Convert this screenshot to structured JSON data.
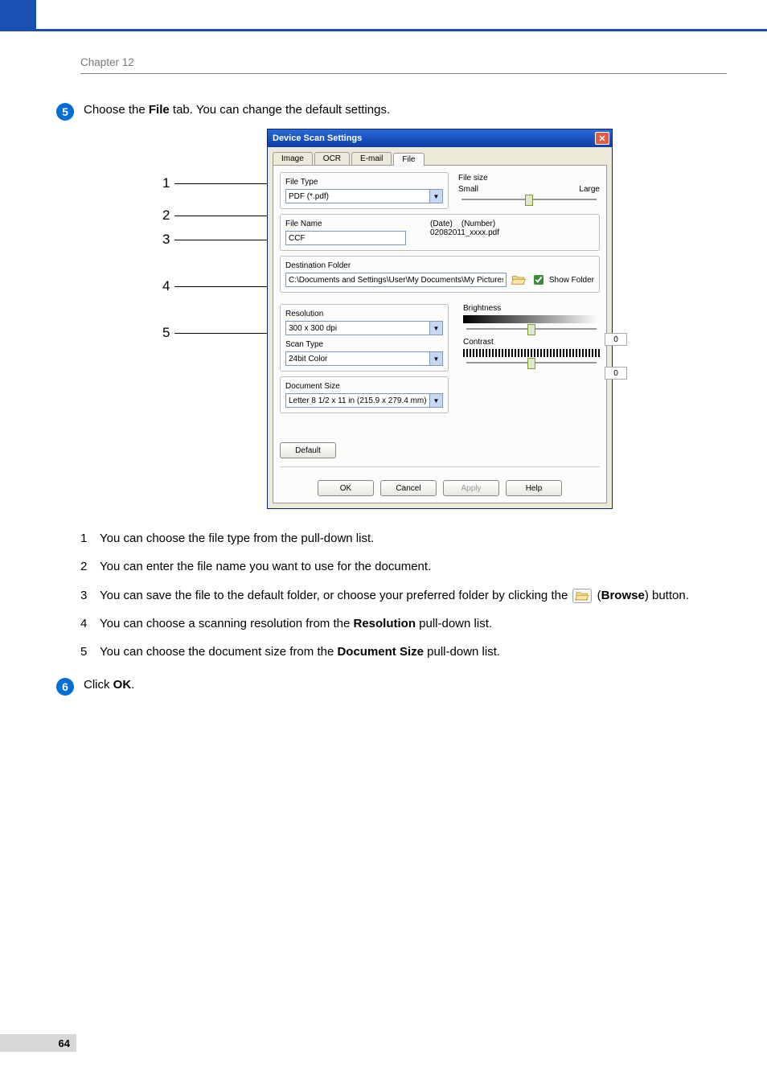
{
  "chapter": "Chapter 12",
  "page_number": "64",
  "step5": {
    "badge": "5",
    "pre": "Choose the ",
    "bold": "File",
    "post": " tab. You can change the default settings."
  },
  "step6": {
    "badge": "6",
    "pre": "Click ",
    "bold": "OK",
    "post": "."
  },
  "callouts": {
    "n1": "1",
    "n2": "2",
    "n3": "3",
    "n4": "4",
    "n5": "5"
  },
  "dialog": {
    "title": "Device Scan Settings",
    "tabs": {
      "image": "Image",
      "ocr": "OCR",
      "email": "E-mail",
      "file": "File"
    },
    "file_type_label": "File Type",
    "file_type_value": "PDF (*.pdf)",
    "file_size_label": "File size",
    "file_size_small": "Small",
    "file_size_large": "Large",
    "file_name_label": "File Name",
    "file_name_value": "CCF",
    "file_name_date": "(Date)",
    "file_name_number": "(Number)",
    "file_name_sample": "02082011_xxxx.pdf",
    "dest_folder_label": "Destination Folder",
    "dest_folder_value": "C:\\Documents and Settings\\User\\My Documents\\My Pictures\\Cc",
    "show_folder_label": "Show Folder",
    "resolution_label": "Resolution",
    "resolution_value": "300 x 300 dpi",
    "scan_type_label": "Scan Type",
    "scan_type_value": "24bit Color",
    "document_size_label": "Document Size",
    "document_size_value": "Letter 8 1/2 x 11 in (215.9 x 279.4 mm)",
    "brightness_label": "Brightness",
    "brightness_value": "0",
    "contrast_label": "Contrast",
    "contrast_value": "0",
    "default_btn": "Default",
    "ok_btn": "OK",
    "cancel_btn": "Cancel",
    "apply_btn": "Apply",
    "help_btn": "Help"
  },
  "explain": {
    "e1": "You can choose the file type from the pull-down list.",
    "e2": "You can enter the file name you want to use for the document.",
    "e3_a": "You can save the file to the default folder, or choose your preferred folder by clicking the ",
    "e3_b": " (",
    "e3_bold": "Browse",
    "e3_c": ") button.",
    "e4_a": "You can choose a scanning resolution from the ",
    "e4_bold": "Resolution",
    "e4_b": " pull-down list.",
    "e5_a": "You can choose the document size from the ",
    "e5_bold": "Document Size",
    "e5_b": " pull-down list."
  }
}
